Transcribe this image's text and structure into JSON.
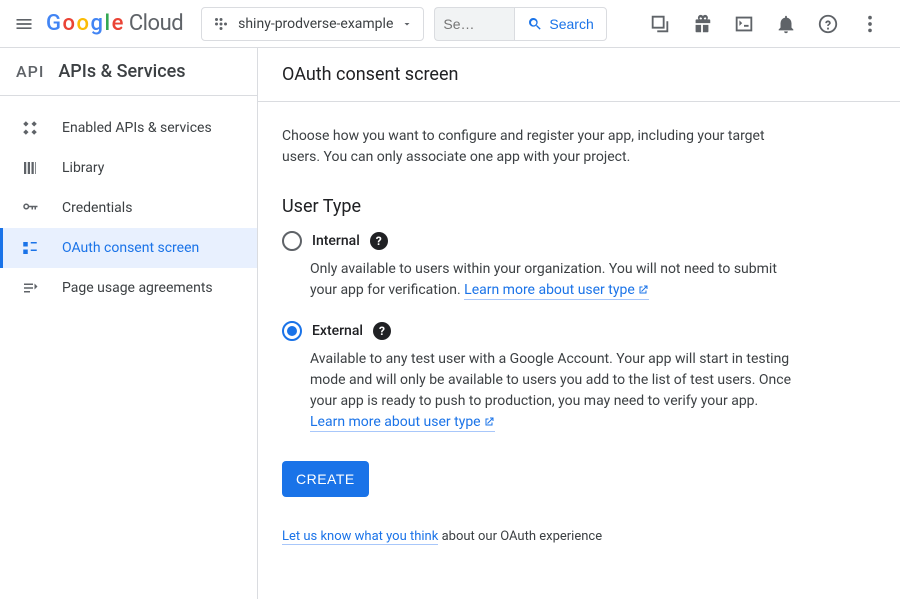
{
  "header": {
    "logo_google": "Google",
    "logo_cloud": "Cloud",
    "project_name": "shiny-prodverse-example",
    "search_placeholder": "Se…",
    "search_button": "Search"
  },
  "sidebar": {
    "api_mark": "API",
    "title": "APIs & Services",
    "items": [
      {
        "label": "Enabled APIs & services",
        "icon": "tiles-icon"
      },
      {
        "label": "Library",
        "icon": "library-icon"
      },
      {
        "label": "Credentials",
        "icon": "key-icon"
      },
      {
        "label": "OAuth consent screen",
        "icon": "consent-icon"
      },
      {
        "label": "Page usage agreements",
        "icon": "agreements-icon"
      }
    ]
  },
  "main": {
    "title": "OAuth consent screen",
    "intro": "Choose how you want to configure and register your app, including your target users. You can only associate one app with your project.",
    "section_heading": "User Type",
    "internal": {
      "label": "Internal",
      "desc_prefix": "Only available to users within your organization. You will not need to submit your app for verification. ",
      "learn_more": "Learn more about user type"
    },
    "external": {
      "label": "External",
      "desc_prefix": "Available to any test user with a Google Account. Your app will start in testing mode and will only be available to users you add to the list of test users. Once your app is ready to push to production, you may need to verify your app. ",
      "learn_more": "Learn more about user type"
    },
    "create_button": "CREATE",
    "feedback_link": "Let us know what you think",
    "feedback_suffix": " about our OAuth experience"
  }
}
